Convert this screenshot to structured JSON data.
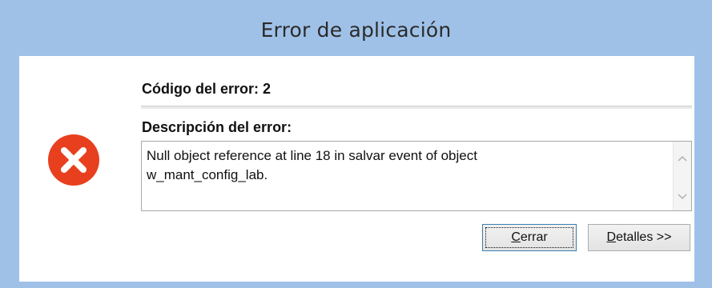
{
  "window": {
    "title": "Error de aplicación"
  },
  "error": {
    "icon": "error-x-circle-icon",
    "icon_color": "#e8401f",
    "code_label": "Código del error: 2",
    "description_label": "Descripción del error:",
    "description_text": "Null object reference at line 18 in salvar event of object\nw_mant_config_lab."
  },
  "buttons": {
    "close_label": "Cerrar",
    "details_label": "Detalles >>"
  },
  "colors": {
    "titlebar": "#9fc1e8",
    "focus_border": "#3c7fb1"
  }
}
